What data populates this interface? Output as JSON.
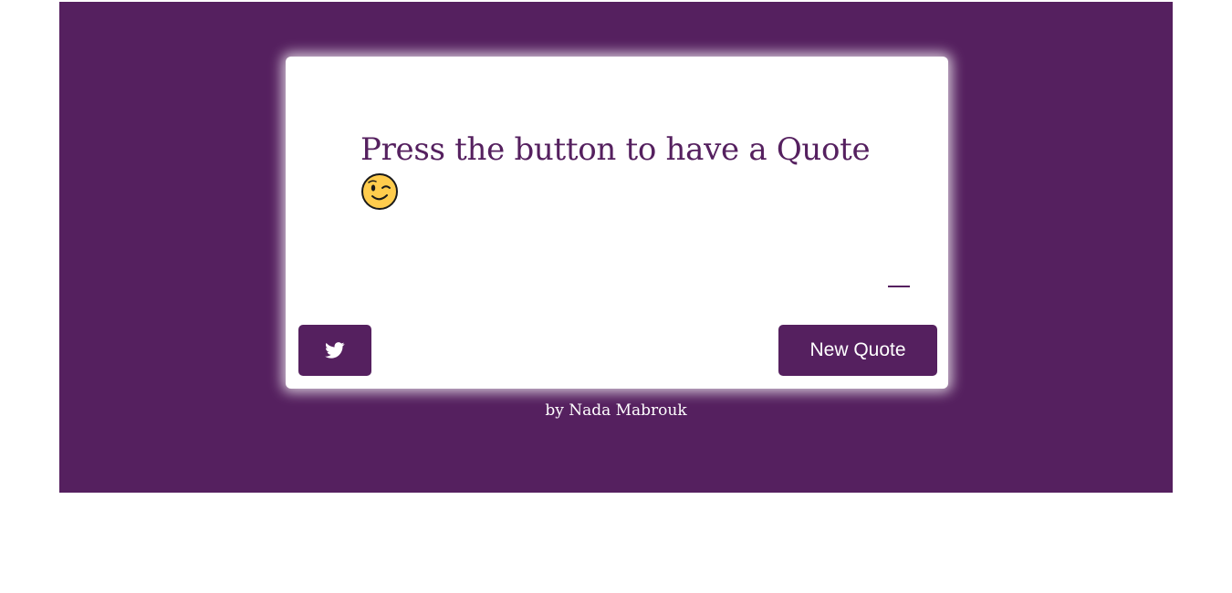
{
  "quote": {
    "text": "Press the button to have a Quote",
    "emoji_icon": "winking-face-emoji",
    "author_dash": "—",
    "author": ""
  },
  "buttons": {
    "tweet_icon": "twitter-icon",
    "new_quote_label": "New Quote"
  },
  "footer": {
    "credit": "by Nada Mabrouk"
  },
  "colors": {
    "accent": "#55205f",
    "card": "#ffffff",
    "page": "#ffffff"
  }
}
